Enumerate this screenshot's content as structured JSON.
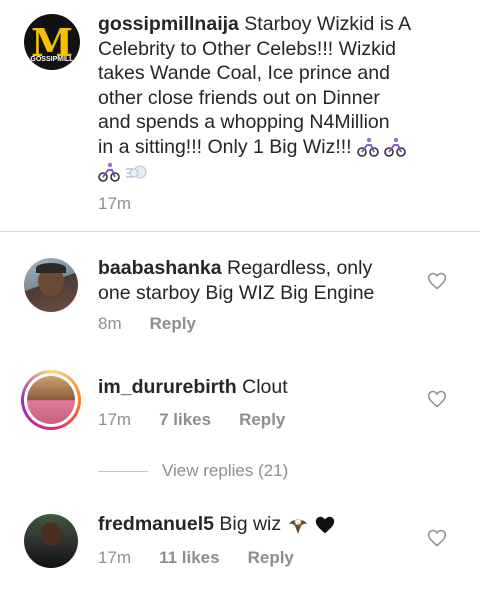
{
  "caption": {
    "username": "gossipmillnaija",
    "avatar_text": "M",
    "avatar_subtext": "GOSSIPMILL",
    "lines": [
      "Starboy Wizkid is A",
      "Celebrity to Other Celebs!!! Wizkid",
      "takes Wande Coal, Ice prince and",
      "other close friends out on Dinner",
      "and spends a whopping N4Million",
      "in a sitting!!! Only 1 Big Wiz!!!"
    ],
    "emojis": [
      "cyclist-emoji",
      "cyclist-emoji",
      "cyclist-emoji",
      "dash-emoji"
    ],
    "time": "17m"
  },
  "comments": [
    {
      "username": "baabashanka",
      "text_lines": [
        "Regardless, only",
        "one starboy Big WIZ Big Engine"
      ],
      "time": "8m",
      "likes": "",
      "reply": "Reply"
    },
    {
      "username": "im_dururebirth",
      "text_lines": [
        "Clout"
      ],
      "time": "17m",
      "likes": "7 likes",
      "reply": "Reply"
    },
    {
      "username": "fredmanuel5",
      "text_lines": [
        "Big wiz"
      ],
      "emojis": [
        "eagle-emoji",
        "black-heart-emoji"
      ],
      "time": "17m",
      "likes": "11 likes",
      "reply": "Reply"
    }
  ],
  "view_replies": "View replies (21)",
  "colors": {
    "text": "#262626",
    "meta": "#8e8e8e",
    "divider": "#dbdbdb",
    "story_ring": "#e1306c",
    "logo_yellow": "#f2c200"
  }
}
